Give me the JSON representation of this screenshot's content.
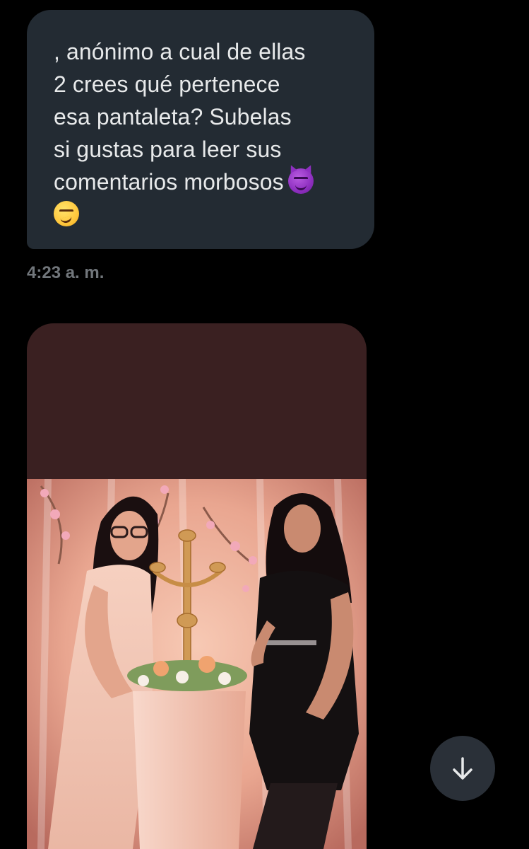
{
  "message": {
    "lines": [
      ", anónimo a cual de ellas",
      "2 crees qué pertenece",
      "esa pantaleta? Subelas",
      "si gustas para leer sus",
      "comentarios morbosos"
    ],
    "emojis": [
      "smiling-face-with-horns-icon",
      "smirking-face-icon"
    ],
    "timestamp": "4:23 a. m."
  },
  "media": {
    "type": "photo",
    "subject": "two women standing beside a floral centerpiece"
  },
  "controls": {
    "scroll_down_icon": "arrow-down-icon"
  },
  "colors": {
    "background": "#000000",
    "bubble": "#232b33",
    "bubble_text": "#e7e9ea",
    "timestamp": "#71767b",
    "media_top": "#3a2021",
    "scroll_button": "#2a3038"
  }
}
